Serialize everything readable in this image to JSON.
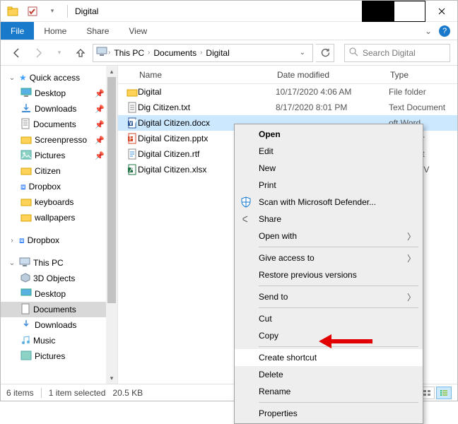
{
  "title": "Digital",
  "ribbon": {
    "file": "File",
    "home": "Home",
    "share": "Share",
    "view": "View"
  },
  "breadcrumbs": [
    "This PC",
    "Documents",
    "Digital"
  ],
  "search_placeholder": "Search Digital",
  "tree": {
    "quick_access": "Quick access",
    "items": [
      "Desktop",
      "Downloads",
      "Documents",
      "Screenpresso",
      "Pictures",
      "Citizen",
      "Dropbox",
      "keyboards",
      "wallpapers"
    ],
    "dropbox": "Dropbox",
    "this_pc": "This PC",
    "pc_items": [
      "3D Objects",
      "Desktop",
      "Documents",
      "Downloads",
      "Music",
      "Pictures"
    ]
  },
  "columns": {
    "name": "Name",
    "date": "Date modified",
    "type": "Type"
  },
  "rows": [
    {
      "icon": "folder",
      "name": "Digital",
      "date": "10/17/2020 4:06 AM",
      "type": "File folder"
    },
    {
      "icon": "txt",
      "name": "Dig Citizen.txt",
      "date": "8/17/2020 8:01 PM",
      "type": "Text Document"
    },
    {
      "icon": "docx",
      "name": "Digital Citizen.docx",
      "date": "",
      "type": "oft Word",
      "selected": true
    },
    {
      "icon": "pptx",
      "name": "Digital Citizen.pptx",
      "date": "",
      "type": "oft Power"
    },
    {
      "icon": "rtf",
      "name": "Digital Citizen.rtf",
      "date": "",
      "type": "xt Format"
    },
    {
      "icon": "xlsx",
      "name": "Digital Citizen.xlsx",
      "date": "",
      "type": "oft Excel V"
    }
  ],
  "ctx": {
    "open": "Open",
    "edit": "Edit",
    "new": "New",
    "print": "Print",
    "scan": "Scan with Microsoft Defender...",
    "share": "Share",
    "openwith": "Open with",
    "giveaccess": "Give access to",
    "restore": "Restore previous versions",
    "sendto": "Send to",
    "cut": "Cut",
    "copy": "Copy",
    "shortcut": "Create shortcut",
    "delete": "Delete",
    "rename": "Rename",
    "props": "Properties"
  },
  "status": {
    "items": "6 items",
    "selected": "1 item selected",
    "size": "20.5 KB"
  }
}
